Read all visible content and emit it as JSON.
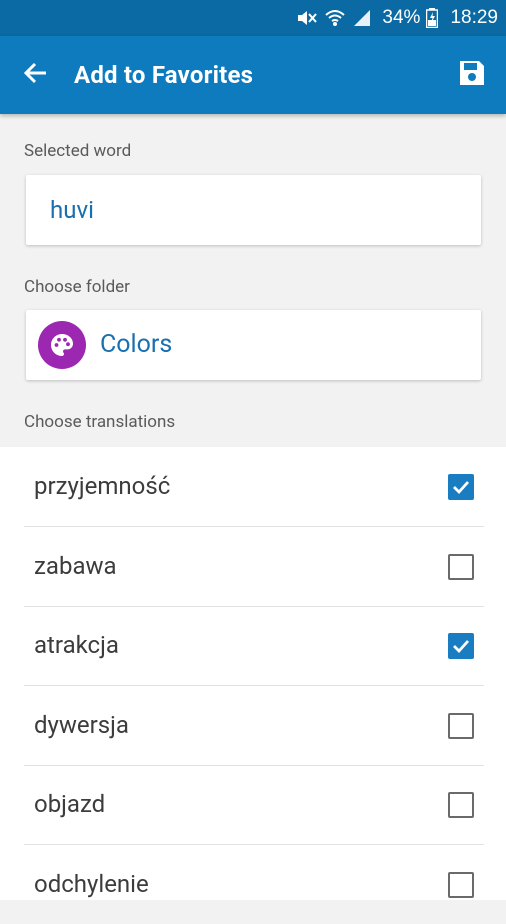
{
  "status_bar": {
    "battery_percent": "34%",
    "time": "18:29",
    "icons": [
      "mute-icon",
      "wifi-icon",
      "signal-icon",
      "battery-icon"
    ]
  },
  "app_bar": {
    "title": "Add to Favorites",
    "back_icon": "arrow-left-icon",
    "save_icon": "save-icon",
    "color": "#0f7bbf"
  },
  "selected_word": {
    "label": "Selected word",
    "value": "huvi"
  },
  "folder": {
    "label": "Choose folder",
    "name": "Colors",
    "icon": "palette-icon",
    "icon_color": "#9c27b0"
  },
  "translations": {
    "label": "Choose translations",
    "items": [
      {
        "text": "przyjemność",
        "checked": true
      },
      {
        "text": "zabawa",
        "checked": false
      },
      {
        "text": "atrakcja",
        "checked": true
      },
      {
        "text": "dywersja",
        "checked": false
      },
      {
        "text": "objazd",
        "checked": false
      },
      {
        "text": "odchylenie",
        "checked": false
      }
    ]
  },
  "accent_color": "#1a7dc2"
}
